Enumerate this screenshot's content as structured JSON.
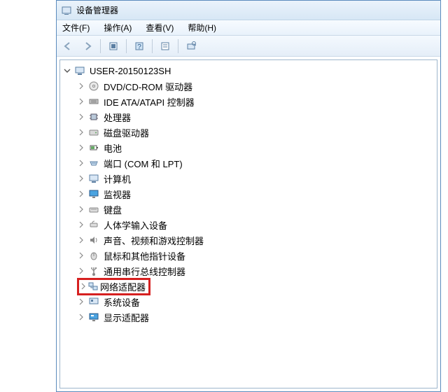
{
  "window": {
    "title": "设备管理器"
  },
  "menubar": {
    "file": "文件(F)",
    "action": "操作(A)",
    "view": "查看(V)",
    "help": "帮助(H)"
  },
  "toolbar": {
    "back": "back",
    "forward": "forward",
    "up_tree": "show-hidden",
    "help": "help",
    "properties": "properties",
    "scan": "scan-hardware"
  },
  "tree": {
    "root": {
      "label": "USER-20150123SH",
      "expanded": true
    },
    "items": [
      {
        "label": "DVD/CD-ROM 驱动器",
        "icon": "disc-icon"
      },
      {
        "label": "IDE ATA/ATAPI 控制器",
        "icon": "ide-icon"
      },
      {
        "label": "处理器",
        "icon": "cpu-icon"
      },
      {
        "label": "磁盘驱动器",
        "icon": "disk-icon"
      },
      {
        "label": "电池",
        "icon": "battery-icon"
      },
      {
        "label": "端口 (COM 和 LPT)",
        "icon": "port-icon"
      },
      {
        "label": "计算机",
        "icon": "computer-icon"
      },
      {
        "label": "监视器",
        "icon": "monitor-icon"
      },
      {
        "label": "键盘",
        "icon": "keyboard-icon"
      },
      {
        "label": "人体学输入设备",
        "icon": "hid-icon"
      },
      {
        "label": "声音、视频和游戏控制器",
        "icon": "sound-icon"
      },
      {
        "label": "鼠标和其他指针设备",
        "icon": "mouse-icon"
      },
      {
        "label": "通用串行总线控制器",
        "icon": "usb-icon"
      },
      {
        "label": "网络适配器",
        "icon": "network-icon",
        "highlighted": true
      },
      {
        "label": "系统设备",
        "icon": "system-icon"
      },
      {
        "label": "显示适配器",
        "icon": "display-icon"
      }
    ]
  }
}
